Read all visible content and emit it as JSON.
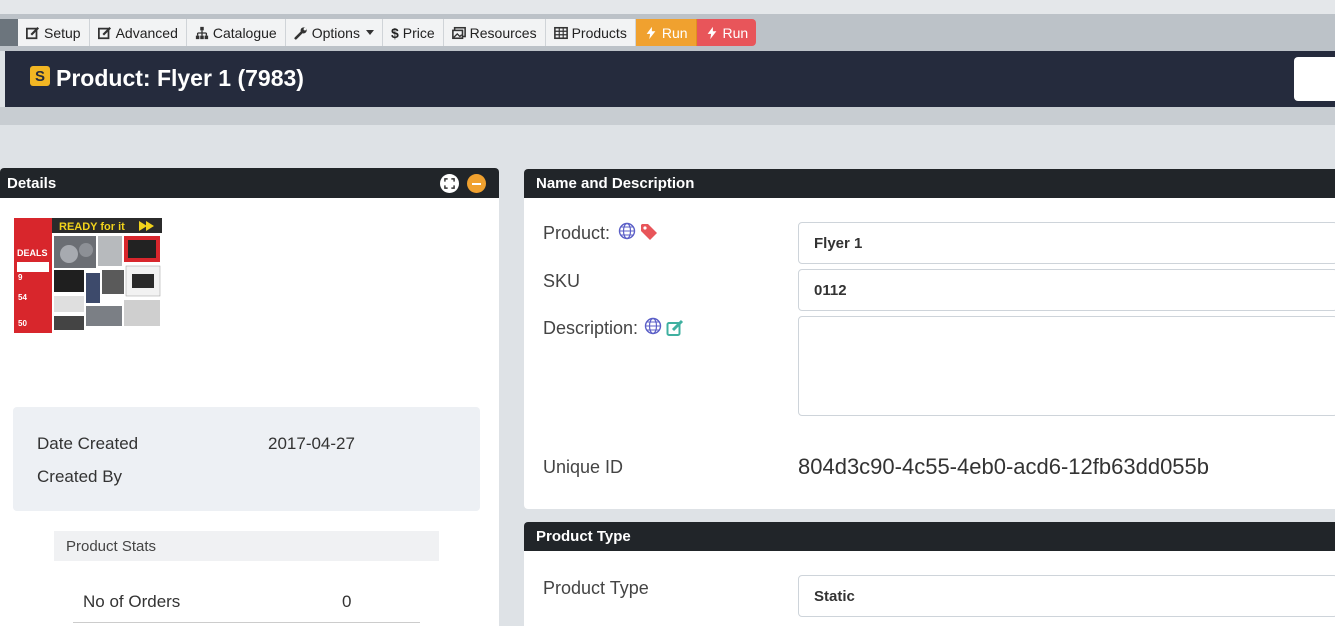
{
  "toolbar": {
    "setup": "Setup",
    "advanced": "Advanced",
    "catalogue": "Catalogue",
    "options": "Options",
    "price": "Price",
    "resources": "Resources",
    "products": "Products",
    "run1": "Run",
    "run2": "Run"
  },
  "header": {
    "badge": "S",
    "title": "Product: Flyer 1 (7983)"
  },
  "details": {
    "title": "Details",
    "date_created_label": "Date Created",
    "date_created_value": "2017-04-27",
    "created_by_label": "Created By",
    "stats_title": "Product Stats",
    "orders_label": "No of Orders",
    "orders_value": "0",
    "thumbnail": {
      "banner": "READY for it",
      "deals": "DEALS",
      "prices": [
        "9",
        "54",
        "50"
      ]
    }
  },
  "name_description": {
    "title": "Name and Description",
    "product_label": "Product:",
    "product_value": "Flyer 1",
    "sku_label": "SKU",
    "sku_value": "0112",
    "description_label": "Description:",
    "description_value": "",
    "unique_id_label": "Unique ID",
    "unique_id_value": "804d3c90-4c55-4eb0-acd6-12fb63dd055b"
  },
  "product_type": {
    "title": "Product Type",
    "label": "Product Type",
    "value": "Static"
  },
  "colors": {
    "header_bg": "#252b3d",
    "panel_head": "#212529",
    "run_orange": "#f0a12f",
    "run_red": "#e8555a",
    "globe": "#5b5fc7",
    "tag": "#e8555a",
    "edit": "#3fb0a0"
  }
}
